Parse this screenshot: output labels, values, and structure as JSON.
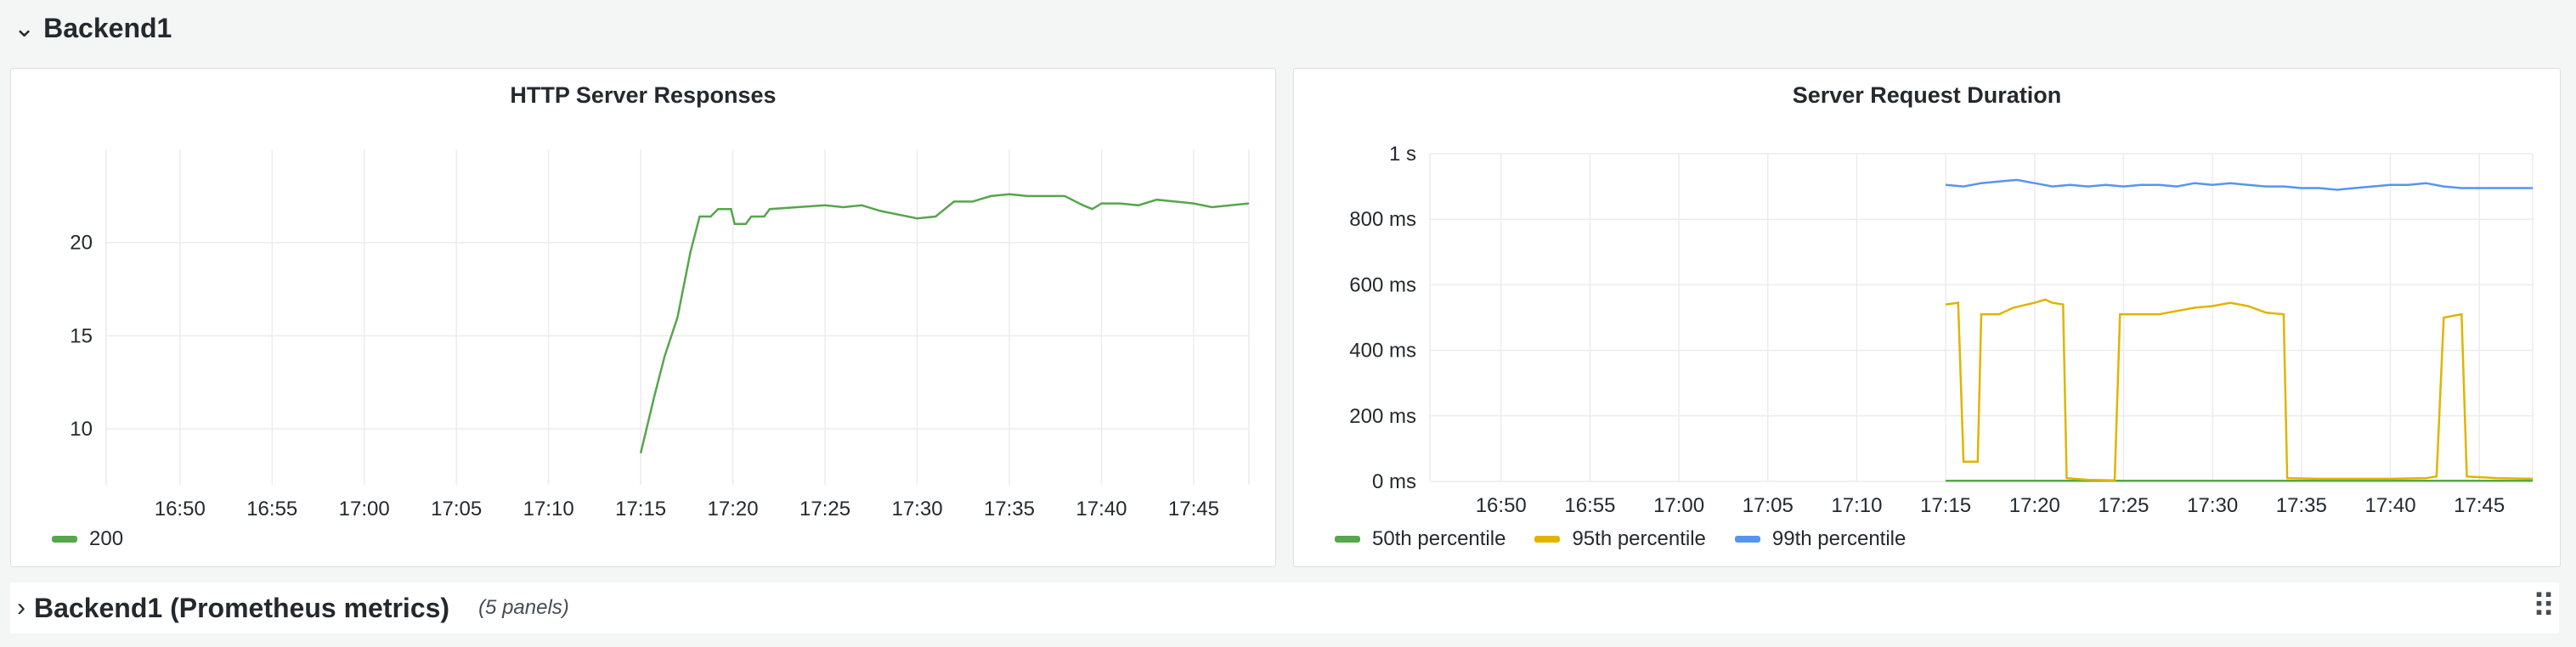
{
  "rows": {
    "top": {
      "chevron": "⌄",
      "title": "Backend1"
    },
    "bottom": {
      "chevron": "›",
      "title": "Backend1 (Prometheus metrics)",
      "panel_count": "(5 panels)",
      "drag_handle": "⠿"
    }
  },
  "panels": [
    {
      "title": "HTTP Server Responses",
      "chart_data": {
        "type": "line",
        "x_ticks": [
          "16:50",
          "16:55",
          "17:00",
          "17:05",
          "17:10",
          "17:15",
          "17:20",
          "17:25",
          "17:30",
          "17:35",
          "17:40",
          "17:45"
        ],
        "y_ticks": [
          "10",
          "15",
          "20"
        ],
        "xlim": [
          "16:46",
          "17:48"
        ],
        "ylim": [
          7,
          25
        ],
        "grid": true,
        "legend_position": "bottom-left",
        "series": [
          {
            "name": "200",
            "color": "#56a64b",
            "points": [
              [
                "17:15",
                8.7
              ],
              [
                "17:15.75",
                11.8
              ],
              [
                "17:16.3",
                13.9
              ],
              [
                "17:17",
                16.0
              ],
              [
                "17:17.7",
                19.5
              ],
              [
                "17:18.2",
                21.4
              ],
              [
                "17:18.8",
                21.4
              ],
              [
                "17:19.2",
                21.8
              ],
              [
                "17:19.9",
                21.8
              ],
              [
                "17:20.1",
                21.0
              ],
              [
                "17:20.7",
                21.0
              ],
              [
                "17:21",
                21.4
              ],
              [
                "17:21.7",
                21.4
              ],
              [
                "17:22",
                21.8
              ],
              [
                "17:23.5",
                21.9
              ],
              [
                "17:25",
                22.0
              ],
              [
                "17:26",
                21.9
              ],
              [
                "17:27",
                22.0
              ],
              [
                "17:28",
                21.7
              ],
              [
                "17:29",
                21.5
              ],
              [
                "17:30",
                21.3
              ],
              [
                "17:31",
                21.4
              ],
              [
                "17:32",
                22.2
              ],
              [
                "17:33",
                22.2
              ],
              [
                "17:34",
                22.5
              ],
              [
                "17:35",
                22.6
              ],
              [
                "17:36",
                22.5
              ],
              [
                "17:37",
                22.5
              ],
              [
                "17:38",
                22.5
              ],
              [
                "17:39",
                22.0
              ],
              [
                "17:39.5",
                21.8
              ],
              [
                "17:40",
                22.1
              ],
              [
                "17:41",
                22.1
              ],
              [
                "17:42",
                22.0
              ],
              [
                "17:43",
                22.3
              ],
              [
                "17:44",
                22.2
              ],
              [
                "17:45",
                22.1
              ],
              [
                "17:46",
                21.9
              ],
              [
                "17:47",
                22.0
              ],
              [
                "17:48",
                22.1
              ]
            ]
          }
        ]
      }
    },
    {
      "title": "Server Request Duration",
      "chart_data": {
        "type": "line",
        "x_ticks": [
          "16:50",
          "16:55",
          "17:00",
          "17:05",
          "17:10",
          "17:15",
          "17:20",
          "17:25",
          "17:30",
          "17:35",
          "17:40",
          "17:45"
        ],
        "y_ticks": [
          "0 ms",
          "200 ms",
          "400 ms",
          "600 ms",
          "800 ms",
          "1 s"
        ],
        "xlim": [
          "16:46",
          "17:48"
        ],
        "ylim_ms": [
          0,
          1000
        ],
        "grid": true,
        "legend_position": "bottom-left",
        "series": [
          {
            "name": "50th percentile",
            "color": "#56a64b",
            "points": [
              [
                "17:15",
                2
              ],
              [
                "17:48",
                2
              ]
            ]
          },
          {
            "name": "95th percentile",
            "color": "#e0b400",
            "points": [
              [
                "17:15",
                540
              ],
              [
                "17:15.7",
                545
              ],
              [
                "17:16",
                60
              ],
              [
                "17:16.8",
                60
              ],
              [
                "17:17",
                510
              ],
              [
                "17:18",
                510
              ],
              [
                "17:18.8",
                530
              ],
              [
                "17:20",
                545
              ],
              [
                "17:20.6",
                555
              ],
              [
                "17:21",
                545
              ],
              [
                "17:21.6",
                540
              ],
              [
                "17:21.8",
                10
              ],
              [
                "17:23",
                5
              ],
              [
                "17:24.5",
                3
              ],
              [
                "17:24.8",
                510
              ],
              [
                "17:27",
                510
              ],
              [
                "17:29",
                530
              ],
              [
                "17:30",
                535
              ],
              [
                "17:31",
                545
              ],
              [
                "17:32",
                535
              ],
              [
                "17:33",
                515
              ],
              [
                "17:34",
                510
              ],
              [
                "17:34.2",
                10
              ],
              [
                "17:36",
                8
              ],
              [
                "17:40",
                8
              ],
              [
                "17:42",
                10
              ],
              [
                "17:42.6",
                15
              ],
              [
                "17:43",
                500
              ],
              [
                "17:44",
                510
              ],
              [
                "17:44.3",
                15
              ],
              [
                "17:46",
                10
              ],
              [
                "17:48",
                8
              ]
            ]
          },
          {
            "name": "99th percentile",
            "color": "#5794f2",
            "points": [
              [
                "17:15",
                905
              ],
              [
                "17:16",
                900
              ],
              [
                "17:17",
                910
              ],
              [
                "17:18",
                915
              ],
              [
                "17:19",
                920
              ],
              [
                "17:20",
                910
              ],
              [
                "17:21",
                900
              ],
              [
                "17:22",
                905
              ],
              [
                "17:23",
                900
              ],
              [
                "17:24",
                905
              ],
              [
                "17:25",
                900
              ],
              [
                "17:26",
                905
              ],
              [
                "17:27",
                905
              ],
              [
                "17:28",
                900
              ],
              [
                "17:29",
                910
              ],
              [
                "17:30",
                905
              ],
              [
                "17:31",
                910
              ],
              [
                "17:32",
                905
              ],
              [
                "17:33",
                900
              ],
              [
                "17:34",
                900
              ],
              [
                "17:35",
                895
              ],
              [
                "17:36",
                895
              ],
              [
                "17:37",
                890
              ],
              [
                "17:38",
                895
              ],
              [
                "17:39",
                900
              ],
              [
                "17:40",
                905
              ],
              [
                "17:41",
                905
              ],
              [
                "17:42",
                910
              ],
              [
                "17:43",
                900
              ],
              [
                "17:44",
                895
              ],
              [
                "17:45",
                895
              ],
              [
                "17:46",
                895
              ],
              [
                "17:47",
                895
              ],
              [
                "17:48",
                895
              ]
            ]
          }
        ]
      }
    }
  ]
}
